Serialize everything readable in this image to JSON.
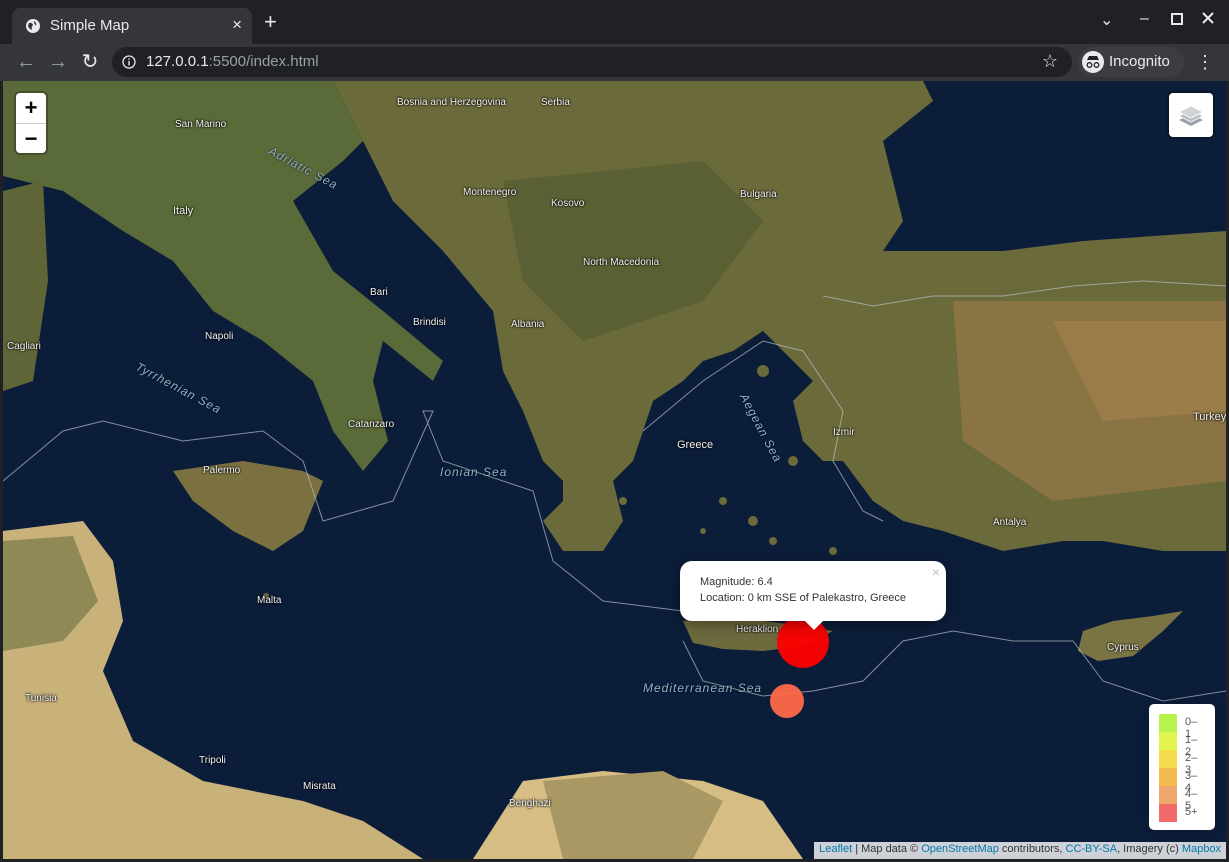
{
  "browser": {
    "tab_title": "Simple Map",
    "tab_close": "×",
    "new_tab": "+",
    "url_host": "127.0.0.1",
    "url_rest": ":5500/index.html",
    "incognito_label": "Incognito"
  },
  "map": {
    "zoom_in": "+",
    "zoom_out": "−",
    "country_labels": [
      "Bosnia and Herzegovina",
      "Serbia",
      "Bulgaria",
      "Montenegro",
      "Kosovo",
      "North Macedonia",
      "Albania",
      "Italy",
      "San Marino",
      "Greece",
      "Turkey",
      "Cyprus",
      "Tunisia",
      "Malta"
    ],
    "city_labels": [
      "Bari",
      "Napoli",
      "Palermo",
      "Brindisi",
      "Heraklion",
      "Tripoli",
      "Benghazi",
      "Misrata",
      "Catanzaro",
      "Cagliari",
      "Izmir",
      "Antalya"
    ],
    "sea_labels": [
      "Adriatic Sea",
      "Tyrrhenian Sea",
      "Ionian Sea",
      "Aegean Sea",
      "Mediterranean Sea"
    ],
    "markers": [
      {
        "magnitude": 6.4,
        "color": "#ff0000"
      },
      {
        "magnitude": 4.5,
        "color": "#ff6a48"
      }
    ]
  },
  "popup": {
    "magnitude_line": "Magnitude: 6.4",
    "location_line": "Location: 0 km SSE of Palekastro, Greece",
    "close": "×"
  },
  "legend": {
    "items": [
      {
        "label": "0–1",
        "color": "#b7f34d"
      },
      {
        "label": "1–2",
        "color": "#e1f34d"
      },
      {
        "label": "2–3",
        "color": "#f3db4d"
      },
      {
        "label": "3–4",
        "color": "#f3ba4d"
      },
      {
        "label": "4–5",
        "color": "#f0a76b"
      },
      {
        "label": "5+",
        "color": "#f06b6b"
      }
    ]
  },
  "attribution": {
    "leaflet": "Leaflet",
    "sep1": " | Map data © ",
    "osm": "OpenStreetMap",
    "sep2": " contributors, ",
    "license": "CC-BY-SA",
    "sep3": ", Imagery (c) ",
    "mapbox": "Mapbox"
  }
}
